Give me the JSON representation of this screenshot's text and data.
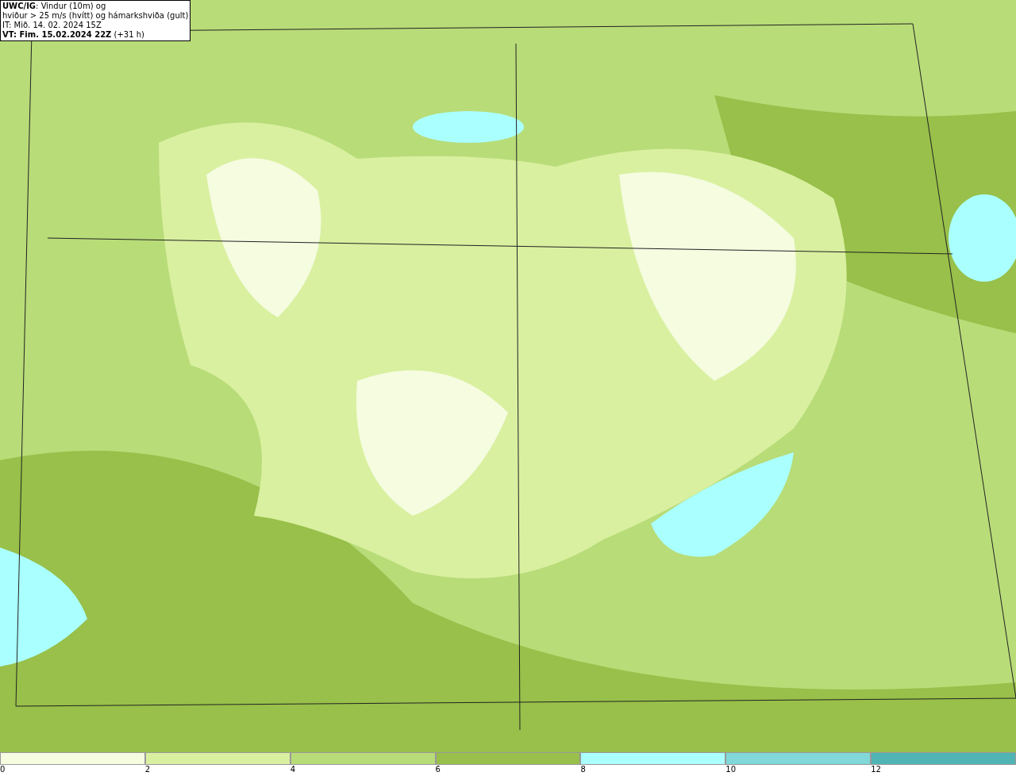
{
  "title_box": {
    "lines": [
      "**UWC/IG**: Vindur (10m) og",
      "hviður > 25 m/s (hvítt) og hámarkshviða (gult)",
      "IT: Mið. 14. 02. 2024 15Z",
      "**VT: Fim. 15.02.2024 22Z** (+31 h)"
    ]
  },
  "legend": {
    "segments": [
      {
        "color": "#f5fce0",
        "label": "0"
      },
      {
        "color": "#d9f0a0",
        "label": "2"
      },
      {
        "color": "#b8dc78",
        "label": "4"
      },
      {
        "color": "#98c04a",
        "label": "6"
      },
      {
        "color": "#aaffff",
        "label": "8"
      },
      {
        "color": "#80d8d8",
        "label": "10"
      },
      {
        "color": "#50b4b4",
        "label": "12"
      }
    ]
  }
}
